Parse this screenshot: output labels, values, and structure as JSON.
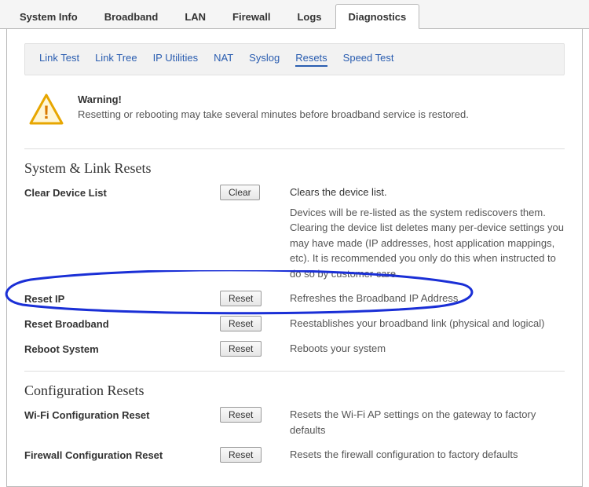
{
  "top_tabs": {
    "system_info": "System Info",
    "broadband": "Broadband",
    "lan": "LAN",
    "firewall": "Firewall",
    "logs": "Logs",
    "diagnostics": "Diagnostics"
  },
  "sub_tabs": {
    "link_test": "Link Test",
    "link_tree": "Link Tree",
    "ip_utilities": "IP Utilities",
    "nat": "NAT",
    "syslog": "Syslog",
    "resets": "Resets",
    "speed_test": "Speed Test"
  },
  "warning": {
    "title": "Warning!",
    "message": "Resetting or rebooting may take several minutes before broadband service is restored."
  },
  "sections": {
    "system_link": "System & Link Resets",
    "config": "Configuration Resets"
  },
  "rows": {
    "clear_device": {
      "label": "Clear Device List",
      "button": "Clear",
      "summary": "Clears the device list.",
      "detail": "Devices will be re-listed as the system rediscovers them. Clearing the device list deletes many per-device settings you may have made (IP addresses, host application mappings, etc). It is recommended you only do this when instructed to do so by customer care."
    },
    "reset_ip": {
      "label": "Reset IP",
      "button": "Reset",
      "summary": "Refreshes the Broadband IP Address"
    },
    "reset_broadband": {
      "label": "Reset Broadband",
      "button": "Reset",
      "summary": "Reestablishes your broadband link (physical and logical)"
    },
    "reboot_system": {
      "label": "Reboot System",
      "button": "Reset",
      "summary": "Reboots your system"
    },
    "wifi_config": {
      "label": "Wi-Fi Configuration Reset",
      "button": "Reset",
      "summary": "Resets the Wi-Fi AP settings on the gateway to factory defaults"
    },
    "firewall_config": {
      "label": "Firewall Configuration Reset",
      "button": "Reset",
      "summary": "Resets the firewall configuration to factory defaults"
    }
  }
}
